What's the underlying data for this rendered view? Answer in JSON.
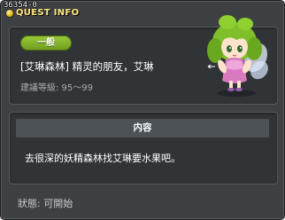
{
  "quest": {
    "id": "36354-0",
    "header_title": "QUEST INFO",
    "category_badge": "一般",
    "name": "[艾琳森林] 精灵的朋友，艾琳",
    "level_label": "建議等級",
    "level_range": "95～99",
    "level_text": "建議等級: 95～99",
    "content_header": "内容",
    "content_text": "去很深的妖精森林找艾琳要水果吧。",
    "status_text": "狀態:  可開始"
  },
  "icons": {
    "header": "quest-bulb-icon",
    "npc": "fairy-npc-portrait"
  },
  "colors": {
    "window_bg": "#3d4144",
    "panel_bg": "#303437",
    "badge_green": "#86b52c",
    "header_text": "#ffe680"
  }
}
